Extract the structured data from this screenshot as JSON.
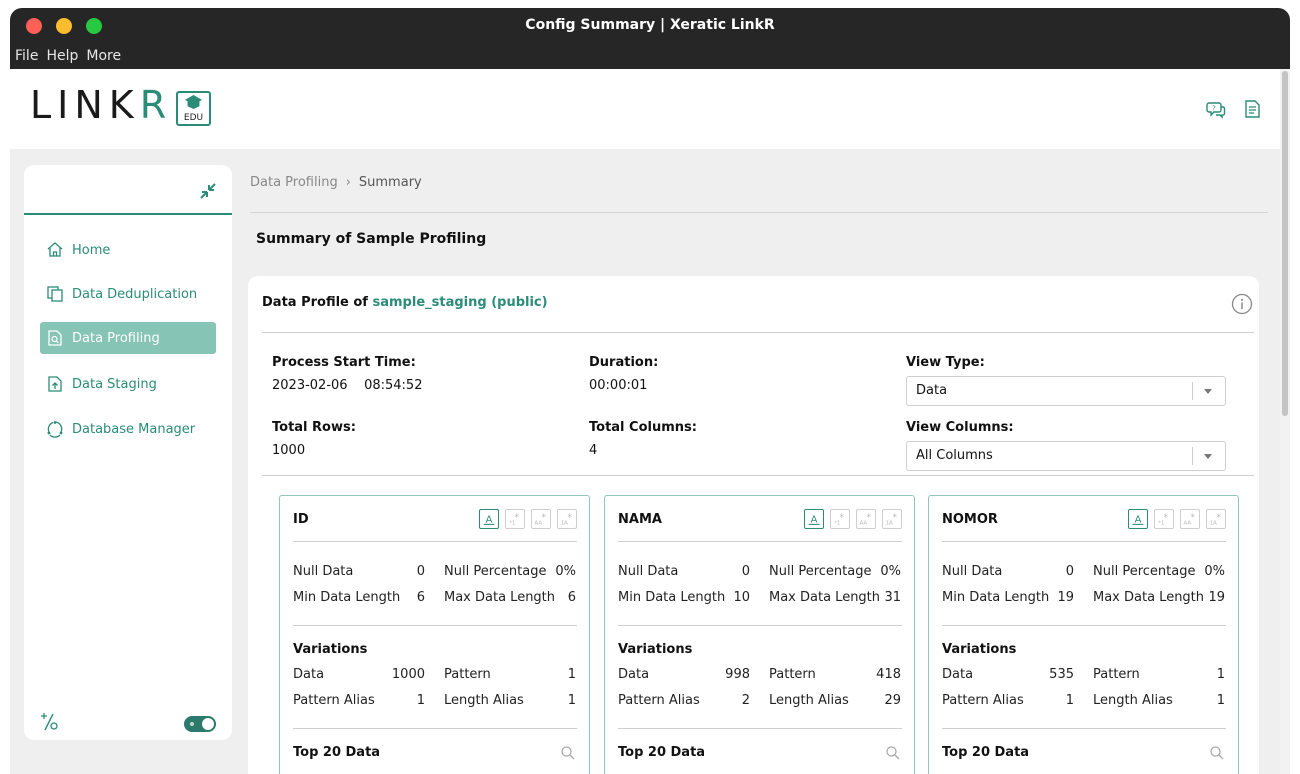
{
  "window": {
    "title": "Config Summary | Xeratic LinkR"
  },
  "menu": [
    "File",
    "Help",
    "More"
  ],
  "brand": {
    "logo_main": "LINK",
    "logo_r": "R",
    "badge": "EDU"
  },
  "sidebar": {
    "items": [
      {
        "label": "Home",
        "icon": "home-icon"
      },
      {
        "label": "Data Deduplication",
        "icon": "copy-icon"
      },
      {
        "label": "Data Profiling",
        "icon": "doc-search-icon",
        "active": true
      },
      {
        "label": "Data Staging",
        "icon": "doc-upload-icon"
      },
      {
        "label": "Database Manager",
        "icon": "database-cycle-icon"
      }
    ]
  },
  "breadcrumb": {
    "parent": "Data Profiling",
    "separator": "›",
    "current": "Summary"
  },
  "page": {
    "title": "Summary of Sample Profiling"
  },
  "profile": {
    "heading_prefix": "Data Profile of",
    "dataset": "sample_staging (public)",
    "process_start_label": "Process Start Time:",
    "process_start_value": "2023-02-06    08:54:52",
    "duration_label": "Duration:",
    "duration_value": "00:00:01",
    "view_type_label": "View Type:",
    "view_type_value": "Data",
    "total_rows_label": "Total Rows:",
    "total_rows_value": "1000",
    "total_columns_label": "Total Columns:",
    "total_columns_value": "4",
    "view_columns_label": "View Columns:",
    "view_columns_value": "All Columns"
  },
  "labels": {
    "null_data": "Null Data",
    "null_percentage": "Null Percentage",
    "min_len": "Min Data Length",
    "max_len": "Max Data Length",
    "variations": "Variations",
    "data": "Data",
    "pattern": "Pattern",
    "pattern_alias": "Pattern Alias",
    "length_alias": "Length Alias",
    "top20": "Top 20 Data"
  },
  "columns": [
    {
      "name": "ID",
      "null_data": "0",
      "null_pct": "0%",
      "min_len": "6",
      "max_len": "6",
      "var_data": "1000",
      "var_pattern": "1",
      "pattern_alias": "1",
      "length_alias": "1"
    },
    {
      "name": "NAMA",
      "null_data": "0",
      "null_pct": "0%",
      "min_len": "10",
      "max_len": "31",
      "var_data": "998",
      "var_pattern": "418",
      "pattern_alias": "2",
      "length_alias": "29"
    },
    {
      "name": "NOMOR",
      "null_data": "0",
      "null_pct": "0%",
      "min_len": "19",
      "max_len": "19",
      "var_data": "535",
      "var_pattern": "1",
      "pattern_alias": "1",
      "length_alias": "1"
    }
  ],
  "colors": {
    "accent": "#2b8c78",
    "active_nav": "#86c4b5",
    "titlebar": "#262626"
  }
}
